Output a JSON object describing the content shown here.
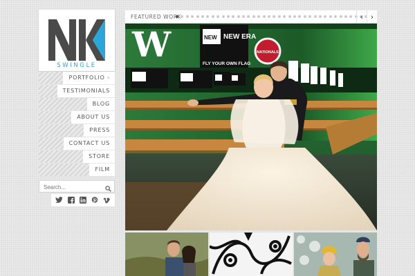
{
  "brand": {
    "logo_letters": "NK",
    "name": "SWINGLE",
    "accent_color": "#2aa6d8",
    "dark_color": "#4a4a4a"
  },
  "nav": {
    "items": [
      {
        "label": "Portfolio",
        "has_dropdown": true
      },
      {
        "label": "Testimonials",
        "has_dropdown": false
      },
      {
        "label": "Blog",
        "has_dropdown": false
      },
      {
        "label": "About Us",
        "has_dropdown": false
      },
      {
        "label": "Press",
        "has_dropdown": false
      },
      {
        "label": "Contact Us",
        "has_dropdown": false
      },
      {
        "label": "Store",
        "has_dropdown": false
      },
      {
        "label": "Film",
        "has_dropdown": false
      }
    ]
  },
  "search": {
    "placeholder": "Search..."
  },
  "social": [
    {
      "icon": "twitter-icon",
      "glyph": "t"
    },
    {
      "icon": "facebook-icon",
      "glyph": "f"
    },
    {
      "icon": "linkedin-icon",
      "glyph": "in"
    },
    {
      "icon": "pinterest-icon",
      "glyph": "p"
    },
    {
      "icon": "vimeo-icon",
      "glyph": "v"
    }
  ],
  "featured": {
    "label": "Featured Work",
    "slide_count": 38,
    "active_slide": 1,
    "prev_glyph": "‹",
    "next_glyph": "›"
  },
  "hero": {
    "banner_text_1": "NEW ERA",
    "banner_text_2": "FLY YOUR OWN FLAG",
    "badge_text": "NATIONALS",
    "team_letter": "W"
  }
}
